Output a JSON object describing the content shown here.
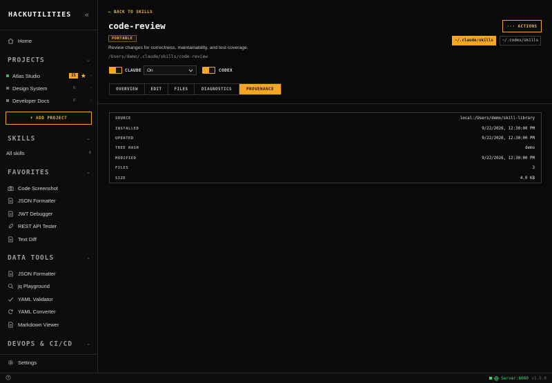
{
  "app": {
    "brand": "HACKUTILITIES"
  },
  "sidebar": {
    "home": "Home",
    "projects": {
      "title": "PROJECTS",
      "items": [
        {
          "name": "Atlas Studio",
          "count": "21",
          "starred": true,
          "dot_color": "#4caf50"
        },
        {
          "name": "Design System",
          "count": "0",
          "dot_color": "#777777"
        },
        {
          "name": "Developer Docs",
          "count": "0",
          "dot_color": "#777777"
        }
      ],
      "add_label": "+ ADD PROJECT"
    },
    "skills": {
      "title": "SKILLS",
      "all_label": "All skills",
      "all_count": "6"
    },
    "favorites": {
      "title": "FAVORITES",
      "items": [
        {
          "label": "Code Screenshot",
          "icon": "camera-icon"
        },
        {
          "label": "JSON Formatter",
          "icon": "file-icon"
        },
        {
          "label": "JWT Debugger",
          "icon": "file-icon"
        },
        {
          "label": "REST API Tester",
          "icon": "rocket-icon"
        },
        {
          "label": "Text Diff",
          "icon": "file-icon"
        }
      ]
    },
    "data_tools": {
      "title": "DATA TOOLS",
      "items": [
        {
          "label": "JSON Formatter",
          "icon": "file-icon"
        },
        {
          "label": "jq Playground",
          "icon": "search-icon"
        },
        {
          "label": "YAML Validator",
          "icon": "check-icon"
        },
        {
          "label": "YAML Converter",
          "icon": "refresh-icon"
        },
        {
          "label": "Markdown Viewer",
          "icon": "file-icon"
        }
      ]
    },
    "devops": {
      "title": "DEVOPS & CI/CD"
    },
    "settings": "Settings"
  },
  "main": {
    "back": "← BACK TO SKILLS",
    "title": "code-review",
    "badge": "PORTABLE",
    "description": "Review changes for correctness, maintainability, and test coverage.",
    "path": "/Users/demo/.claude/skills/code-review",
    "claude_label": "CLAUDE",
    "claude_select": "On",
    "codex_label": "CODEX",
    "actions_label": "··· ACTIONS",
    "path_buttons": [
      "~/.claude/skills",
      "~/.codex/skills"
    ],
    "tabs": [
      "OVERVIEW",
      "EDIT",
      "FILES",
      "DIAGNOSTICS",
      "PROVENANCE"
    ],
    "active_tab": "PROVENANCE"
  },
  "provenance": [
    {
      "key": "SOURCE",
      "value": "local:/Users/demo/skill-library"
    },
    {
      "key": "INSTALLED",
      "value": "9/22/2026, 12:30:00 PM"
    },
    {
      "key": "UPDATED",
      "value": "9/22/2026, 12:30:00 PM"
    },
    {
      "key": "TREE HASH",
      "value": "demo"
    },
    {
      "key": "MODIFIED",
      "value": "9/22/2026, 12:30:00 PM"
    },
    {
      "key": "FILES",
      "value": "3"
    },
    {
      "key": "SIZE",
      "value": "4.0 KB"
    }
  ],
  "statusbar": {
    "server": "Server:8080",
    "version": "v3.5.0"
  },
  "colors": {
    "accent": "#f5a623",
    "server_ok": "#4fd66a"
  }
}
